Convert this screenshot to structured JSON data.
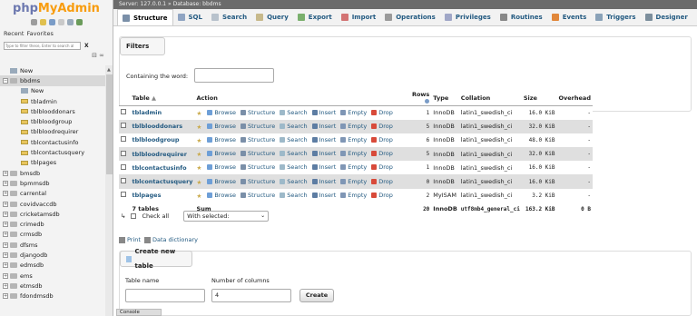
{
  "logo": {
    "php": "php",
    "my": "MyAdmin"
  },
  "nav_tabs": {
    "recent": "Recent",
    "favorites": "Favorites"
  },
  "filter": {
    "placeholder": "Type to filter these, Enter to search al",
    "clear": "X"
  },
  "collapse_label": "⊟ ∞",
  "tree": [
    {
      "label": "New",
      "kind": "new",
      "indent": 0
    },
    {
      "label": "bbdms",
      "kind": "db",
      "indent": 0,
      "active": true,
      "expanded": true
    },
    {
      "label": "New",
      "kind": "new",
      "indent": 1
    },
    {
      "label": "tbladmin",
      "kind": "table",
      "indent": 1
    },
    {
      "label": "tblblooddonars",
      "kind": "table",
      "indent": 1
    },
    {
      "label": "tblbloodgroup",
      "kind": "table",
      "indent": 1
    },
    {
      "label": "tblbloodrequirer",
      "kind": "table",
      "indent": 1
    },
    {
      "label": "tblcontactusinfo",
      "kind": "table",
      "indent": 1
    },
    {
      "label": "tblcontactusquery",
      "kind": "table",
      "indent": 1
    },
    {
      "label": "tblpages",
      "kind": "table",
      "indent": 1
    },
    {
      "label": "bmsdb",
      "kind": "db",
      "indent": 0
    },
    {
      "label": "bpmmsdb",
      "kind": "db",
      "indent": 0
    },
    {
      "label": "carrental",
      "kind": "db",
      "indent": 0
    },
    {
      "label": "covidvaccdb",
      "kind": "db",
      "indent": 0
    },
    {
      "label": "cricketamsdb",
      "kind": "db",
      "indent": 0
    },
    {
      "label": "crimedb",
      "kind": "db",
      "indent": 0
    },
    {
      "label": "crmsdb",
      "kind": "db",
      "indent": 0
    },
    {
      "label": "dfsms",
      "kind": "db",
      "indent": 0
    },
    {
      "label": "djangodb",
      "kind": "db",
      "indent": 0
    },
    {
      "label": "edmsdb",
      "kind": "db",
      "indent": 0
    },
    {
      "label": "ems",
      "kind": "db",
      "indent": 0
    },
    {
      "label": "etmsdb",
      "kind": "db",
      "indent": 0
    },
    {
      "label": "fdondmsdb",
      "kind": "db",
      "indent": 0
    }
  ],
  "breadcrumb": "Server: 127.0.0.1 » Database: bbdms",
  "menu": [
    {
      "label": "Structure",
      "color": "#7a8fa8",
      "active": true
    },
    {
      "label": "SQL",
      "color": "#8fa4c2"
    },
    {
      "label": "Search",
      "color": "#b8c2cc"
    },
    {
      "label": "Query",
      "color": "#c7b98b"
    },
    {
      "label": "Export",
      "color": "#7ab06d"
    },
    {
      "label": "Import",
      "color": "#d37474"
    },
    {
      "label": "Operations",
      "color": "#9a9a9a"
    },
    {
      "label": "Privileges",
      "color": "#a0a7c7"
    },
    {
      "label": "Routines",
      "color": "#888888"
    },
    {
      "label": "Events",
      "color": "#e1873a"
    },
    {
      "label": "Triggers",
      "color": "#8aa2b8"
    },
    {
      "label": "Designer",
      "color": "#7c8e9c"
    }
  ],
  "filters": {
    "title": "Filters",
    "label": "Containing the word:"
  },
  "table_headers": {
    "table": "Table",
    "sort": "▲",
    "action": "Action",
    "rows": "Rows",
    "type": "Type",
    "collation": "Collation",
    "size": "Size",
    "overhead": "Overhead"
  },
  "actions": [
    "Browse",
    "Structure",
    "Search",
    "Insert",
    "Empty",
    "Drop"
  ],
  "action_colors": [
    "#6e9fd7",
    "#7a8fa8",
    "#9db9c9",
    "#5d7da3",
    "#7f96b5",
    "#d84a3a"
  ],
  "tables": [
    {
      "name": "tbladmin",
      "rows": "1",
      "type": "InnoDB",
      "collation": "latin1_swedish_ci",
      "size": "16.0 KiB",
      "overhead": "-"
    },
    {
      "name": "tblblooddonars",
      "rows": "5",
      "type": "InnoDB",
      "collation": "latin1_swedish_ci",
      "size": "32.0 KiB",
      "overhead": "-"
    },
    {
      "name": "tblbloodgroup",
      "rows": "6",
      "type": "InnoDB",
      "collation": "latin1_swedish_ci",
      "size": "48.0 KiB",
      "overhead": "-"
    },
    {
      "name": "tblbloodrequirer",
      "rows": "5",
      "type": "InnoDB",
      "collation": "latin1_swedish_ci",
      "size": "32.0 KiB",
      "overhead": "-"
    },
    {
      "name": "tblcontactusinfo",
      "rows": "1",
      "type": "InnoDB",
      "collation": "latin1_swedish_ci",
      "size": "16.0 KiB",
      "overhead": "-"
    },
    {
      "name": "tblcontactusquery",
      "rows": "0",
      "type": "InnoDB",
      "collation": "latin1_swedish_ci",
      "size": "16.0 KiB",
      "overhead": "-"
    },
    {
      "name": "tblpages",
      "rows": "2",
      "type": "MyISAM",
      "collation": "latin1_swedish_ci",
      "size": "3.2 KiB",
      "overhead": "-"
    }
  ],
  "totals": {
    "label": "7 tables",
    "action": "Sum",
    "rows": "20",
    "type": "InnoDB",
    "collation": "utf8mb4_general_ci",
    "size": "163.2 KiB",
    "overhead": "0 B"
  },
  "bulk": {
    "check_all": "Check all",
    "with_selected": "With selected:"
  },
  "links": {
    "print": "Print",
    "dictionary": "Data dictionary"
  },
  "create": {
    "title": "Create new table",
    "name_label": "Table name",
    "cols_label": "Number of columns",
    "cols_value": "4",
    "button": "Create"
  },
  "console": "Console"
}
